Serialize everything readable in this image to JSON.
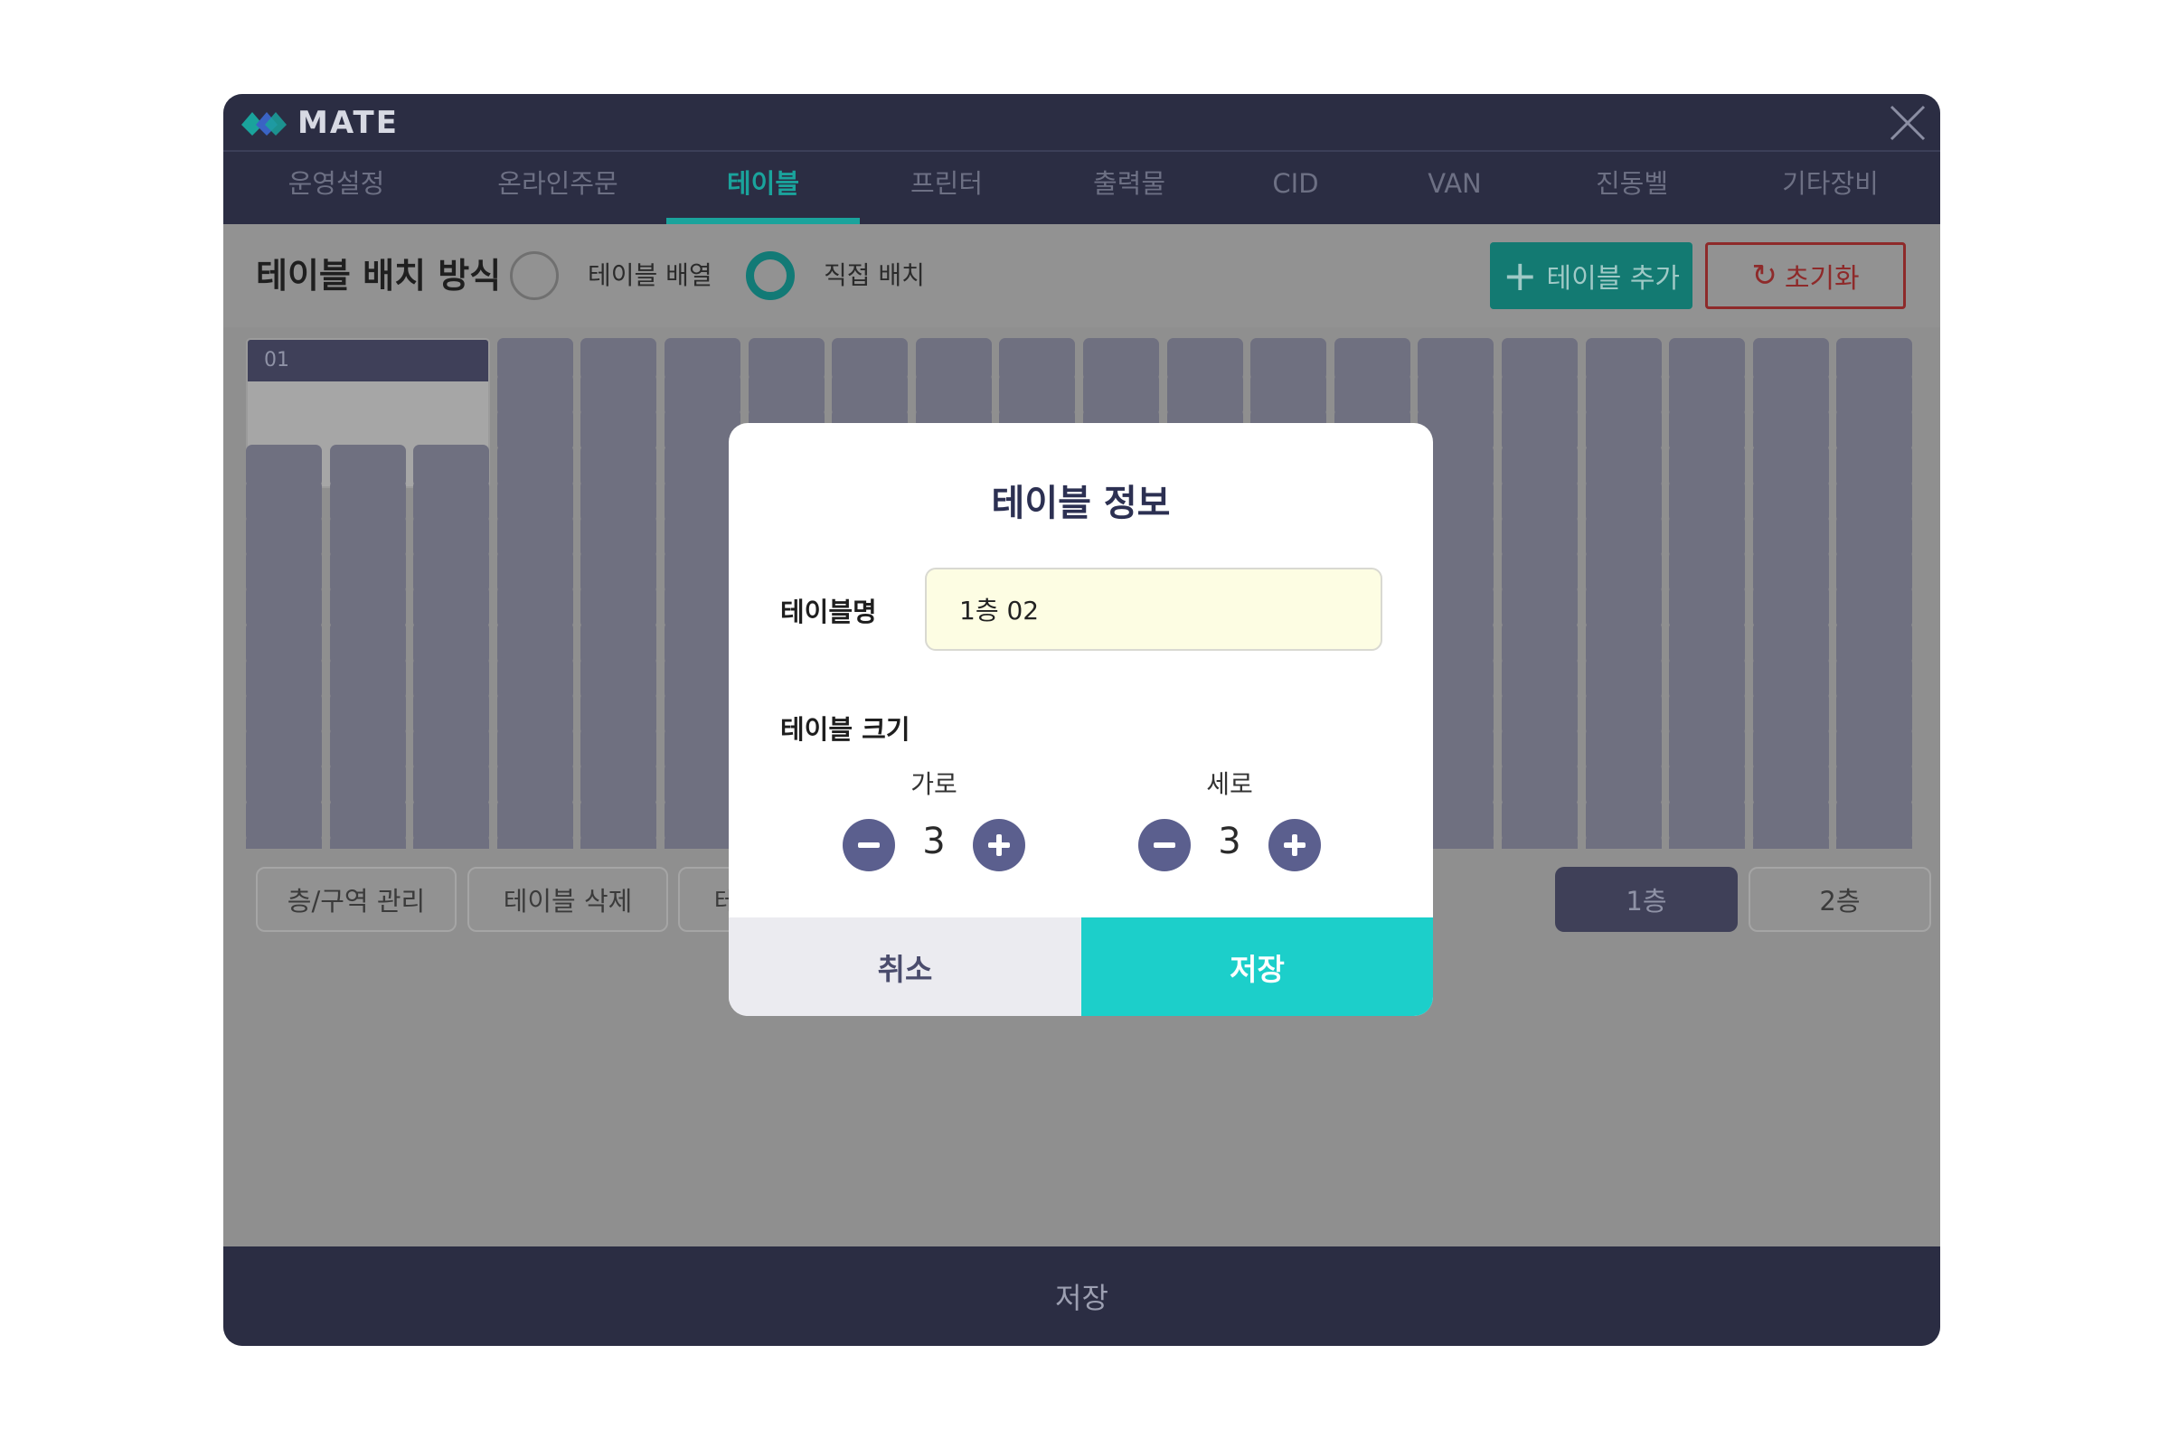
{
  "app": {
    "logo_text": "MATE"
  },
  "tabs": [
    {
      "label": "운영설정"
    },
    {
      "label": "온라인주문"
    },
    {
      "label": "테이블"
    },
    {
      "label": "프린터"
    },
    {
      "label": "출력물"
    },
    {
      "label": "CID"
    },
    {
      "label": "VAN"
    },
    {
      "label": "진동벨"
    },
    {
      "label": "기타장비"
    }
  ],
  "active_tab": "테이블",
  "toolbar": {
    "title": "테이블 배치 방식",
    "option_array": "테이블 배열",
    "option_manual": "직접 배치",
    "selected_option": "직접 배치",
    "add_label": "테이블 추가",
    "reset_label": "초기화"
  },
  "grid": {
    "rows": 15,
    "cols": 20,
    "table_01": {
      "label": "01",
      "cols_span": 3,
      "rows_span": 3
    }
  },
  "bottom": {
    "floor_manage": "층/구역 관리",
    "delete_table": "테이블 삭제",
    "edit_table": "테이블 수정",
    "floors": [
      "1층",
      "2층"
    ],
    "active_floor": "1층"
  },
  "save_bar": {
    "label": "저장"
  },
  "modal": {
    "title": "테이블 정보",
    "name_label": "테이블명",
    "name_value": "1층 02",
    "size_label": "테이블 크기",
    "width_label": "가로",
    "width_value": "3",
    "height_label": "세로",
    "height_value": "3",
    "cancel_label": "취소",
    "save_label": "저장"
  },
  "colors": {
    "accent": "#1ccfca",
    "tab_active": "#1aa39c",
    "header_bg": "#2b2d43",
    "stepper": "#5b5f8e",
    "reset": "#8e2a2a"
  }
}
